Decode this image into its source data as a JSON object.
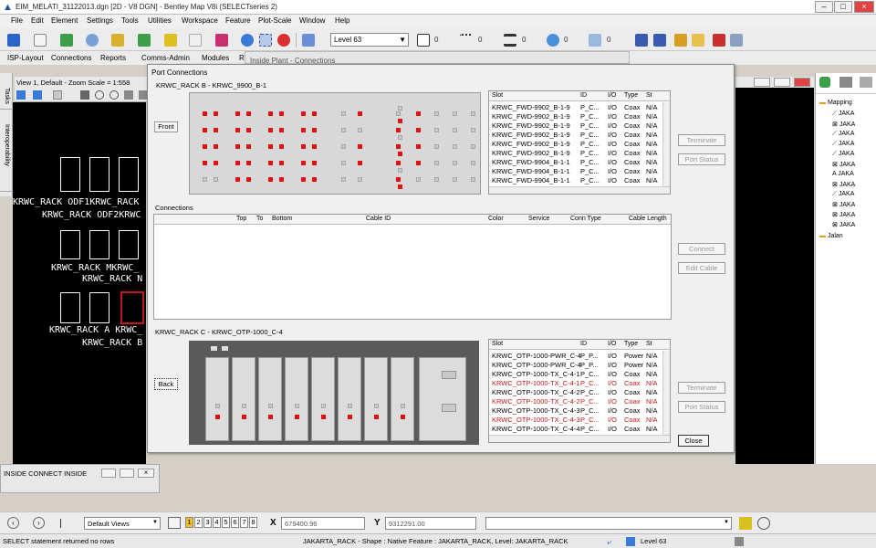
{
  "app": {
    "title": "EIM_MELATI_31122013.dgn [2D - V8 DGN] - Bentley Map V8i (SELECTseries 2)"
  },
  "menu": [
    "File",
    "Edit",
    "Element",
    "Settings",
    "Tools",
    "Utilities",
    "Workspace",
    "Feature",
    "Plot-Scale",
    "Window",
    "Help"
  ],
  "toolbar": {
    "level": "Level 63",
    "color_value": "0",
    "style_value": "0",
    "weight_value": "0",
    "transparency_value": "0",
    "priority_value": "0"
  },
  "tasks": [
    "ISP-Layout",
    "Connections",
    "Reports",
    "Comms-Admin",
    "Modules",
    "Re",
    "Inside Plant - Connections"
  ],
  "left_tabs": [
    "Tasks",
    "Interoperability"
  ],
  "view": {
    "header": "View 1, Default - Zoom Scale = 1:558",
    "cad_labels": [
      "KRWC_RACK ODF1KRWC_RACK",
      "KRWC_RACK ODF2KRWC",
      "KRWC_RACK MKRWC_",
      "KRWC_RACK N",
      "KRWC_RACK A KRWC_",
      "KRWC_RACK B"
    ]
  },
  "tree": {
    "root": "Mapping",
    "items": [
      "JAKA",
      "JAKA",
      "JAKA",
      "JAKA",
      "JAKA",
      "JAKA",
      "JAKA",
      "JAKA",
      "JAKA",
      "JAKA",
      "JAKA",
      "JAKA"
    ],
    "folder2": "Jalan"
  },
  "dialog": {
    "title": "Port Connections",
    "top_rack_label": "KRWC_RACK B - KRWC_9900_B-1",
    "front_button": "Front",
    "top_grid": {
      "headers": [
        "Slot",
        "ID",
        "I/O",
        "Type",
        "St"
      ],
      "rows": [
        {
          "slot": "KRWC_FWD-9902_B-1-9",
          "id": "P_C...",
          "io": "I/O",
          "type": "Coax",
          "st": "N/A"
        },
        {
          "slot": "KRWC_FWD-9902_B-1-9",
          "id": "P_C...",
          "io": "I/O",
          "type": "Coax",
          "st": "N/A"
        },
        {
          "slot": "KRWC_FWD-9902_B-1-9",
          "id": "P_C...",
          "io": "I/O",
          "type": "Coax",
          "st": "N/A"
        },
        {
          "slot": "KRWC_FWD-9902_B-1-9",
          "id": "P_C...",
          "io": "I/O",
          "type": "Coax",
          "st": "N/A"
        },
        {
          "slot": "KRWC_FWD-9902_B-1-9",
          "id": "P_C...",
          "io": "I/O",
          "type": "Coax",
          "st": "N/A"
        },
        {
          "slot": "KRWC_FWD-9902_B-1-9",
          "id": "P_C...",
          "io": "I/O",
          "type": "Coax",
          "st": "N/A"
        },
        {
          "slot": "KRWC_FWD-9904_B-1-1",
          "id": "P_C...",
          "io": "I/O",
          "type": "Coax",
          "st": "N/A"
        },
        {
          "slot": "KRWC_FWD-9904_B-1-1",
          "id": "P_C...",
          "io": "I/O",
          "type": "Coax",
          "st": "N/A"
        },
        {
          "slot": "KRWC_FWD-9904_B-1-1",
          "id": "P_C...",
          "io": "I/O",
          "type": "Coax",
          "st": "N/A"
        }
      ]
    },
    "terminate_label": "Terminate",
    "port_status_label": "Port Status",
    "connections_label": "Connections",
    "conn_headers": [
      "Top",
      "To",
      "Bottom",
      "Cable ID",
      "Color",
      "Service",
      "Conn Type",
      "Cable Length"
    ],
    "connect_label": "Connect",
    "edit_cable_label": "Edit Cable",
    "bottom_rack_label": "KRWC_RACK C - KRWC_OTP-1000_C-4",
    "back_button": "Back",
    "bottom_grid": {
      "headers": [
        "Slot",
        "ID",
        "I/O",
        "Type",
        "St"
      ],
      "rows": [
        {
          "slot": "KRWC_OTP-1000-PWR_C-4",
          "id": "P_P...",
          "io": "I/O",
          "type": "Power",
          "st": "N/A",
          "red": false
        },
        {
          "slot": "KRWC_OTP-1000-PWR_C-4",
          "id": "P_P...",
          "io": "I/O",
          "type": "Power",
          "st": "N/A",
          "red": false
        },
        {
          "slot": "KRWC_OTP-1000-TX_C-4-1",
          "id": "P_C...",
          "io": "I/O",
          "type": "Coax",
          "st": "N/A",
          "red": false
        },
        {
          "slot": "KRWC_OTP-1000-TX_C-4-1",
          "id": "P_C...",
          "io": "I/O",
          "type": "Coax",
          "st": "N/A",
          "red": true
        },
        {
          "slot": "KRWC_OTP-1000-TX_C-4-2",
          "id": "P_C...",
          "io": "I/O",
          "type": "Coax",
          "st": "N/A",
          "red": false
        },
        {
          "slot": "KRWC_OTP-1000-TX_C-4-2",
          "id": "P_C...",
          "io": "I/O",
          "type": "Coax",
          "st": "N/A",
          "red": true
        },
        {
          "slot": "KRWC_OTP-1000-TX_C-4-3",
          "id": "P_C...",
          "io": "I/O",
          "type": "Coax",
          "st": "N/A",
          "red": false
        },
        {
          "slot": "KRWC_OTP-1000-TX_C-4-3",
          "id": "P_C...",
          "io": "I/O",
          "type": "Coax",
          "st": "N/A",
          "red": true
        },
        {
          "slot": "KRWC_OTP-1000-TX_C-4-4",
          "id": "P_C...",
          "io": "I/O",
          "type": "Coax",
          "st": "N/A",
          "red": false
        }
      ]
    },
    "close_label": "Close"
  },
  "inside_connect": {
    "title": "INSIDE CONNECT INSIDE"
  },
  "bottom": {
    "views_label": "Default Views",
    "pages": [
      "1",
      "2",
      "3",
      "4",
      "5",
      "6",
      "7",
      "8"
    ],
    "x_label": "X",
    "x_value": "679400.96",
    "y_label": "Y",
    "y_value": "9312291.00"
  },
  "status": {
    "left": "SELECT statement returned no rows",
    "middle": "JAKARTA_RACK - Shape : Native Feature : JAKARTA_RACK, Level: JAKARTA_RACK",
    "level": "Level 63"
  },
  "colors": {
    "port_red": "#e01010",
    "red_text": "#c01818"
  }
}
